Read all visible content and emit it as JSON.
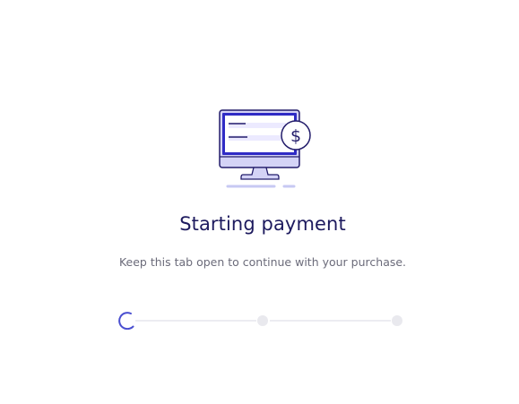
{
  "payment_status": {
    "title": "Starting payment",
    "message": "Keep this tab open to continue with your purchase."
  },
  "illustration": {
    "icon": "computer-dollar-icon",
    "currency_symbol": "$"
  },
  "progress": {
    "steps": 3,
    "current_step": 1,
    "active_color": "#4a4fd0",
    "inactive_color": "#e9e9ee"
  },
  "colors": {
    "title": "#1d1a5e",
    "accent": "#2f2bc5",
    "text_muted": "#6b6b7a"
  }
}
